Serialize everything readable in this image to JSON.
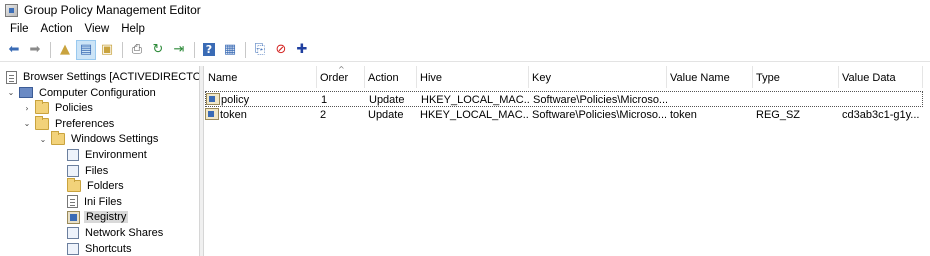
{
  "window": {
    "title": "Group Policy Management Editor"
  },
  "menu": [
    "File",
    "Action",
    "View",
    "Help"
  ],
  "toolbar": {
    "buttons": [
      {
        "name": "back-button",
        "icon": "arrow-left-icon",
        "glyph": "⬅",
        "color": "#3a6bb5"
      },
      {
        "name": "forward-button",
        "icon": "arrow-right-icon",
        "glyph": "➡",
        "color": "#8a8a8a"
      },
      {
        "name": "up-folder-button",
        "icon": "up-folder-icon",
        "glyph": "▲",
        "color": "#c9a33e"
      },
      {
        "name": "show-hide-tree-button",
        "icon": "console-tree-icon",
        "glyph": "▤",
        "color": "#3a6bb5",
        "active": true
      },
      {
        "name": "copy-button",
        "icon": "clipboard-icon",
        "glyph": "▣",
        "color": "#c9a33e"
      },
      {
        "name": "print-button",
        "icon": "printer-icon",
        "glyph": "⎙",
        "color": "#555555"
      },
      {
        "name": "refresh-button",
        "icon": "refresh-icon",
        "glyph": "↻",
        "color": "#2e8b3a"
      },
      {
        "name": "export-list-button",
        "icon": "export-icon",
        "glyph": "⇥",
        "color": "#2e8b3a"
      },
      {
        "name": "help-button",
        "icon": "help-icon",
        "glyph": "?",
        "color": "#ffffff",
        "bg": "#3a6bb5"
      },
      {
        "name": "properties-button",
        "icon": "properties-icon",
        "glyph": "▦",
        "color": "#3a6bb5"
      },
      {
        "name": "new-item-button",
        "icon": "new-document-icon",
        "glyph": "⎘",
        "color": "#3a6bb5"
      },
      {
        "name": "disable-item-button",
        "icon": "prohibited-icon",
        "glyph": "⊘",
        "color": "#d3201e"
      },
      {
        "name": "add-item-button",
        "icon": "plus-icon",
        "glyph": "✚",
        "color": "#1f3f9f"
      }
    ]
  },
  "tree": [
    {
      "label": "Browser Settings [ACTIVEDIRECTORY.I",
      "icon": "policy-document-icon",
      "icon_class": "doc",
      "level": 0,
      "chevron": ""
    },
    {
      "label": "Computer Configuration",
      "icon": "computer-icon",
      "icon_class": "computer",
      "level": 0,
      "chevron": "⌄"
    },
    {
      "label": "Policies",
      "icon": "folder-icon",
      "icon_class": "folder",
      "level": 1,
      "chevron": "›"
    },
    {
      "label": "Preferences",
      "icon": "folder-icon",
      "icon_class": "folder",
      "level": 1,
      "chevron": "⌄"
    },
    {
      "label": "Windows Settings",
      "icon": "folder-icon",
      "icon_class": "folder",
      "level": 2,
      "chevron": "⌄"
    },
    {
      "label": "Environment",
      "icon": "environment-icon",
      "icon_class": "generic",
      "level": 3,
      "chevron": ""
    },
    {
      "label": "Files",
      "icon": "files-icon",
      "icon_class": "generic",
      "level": 3,
      "chevron": ""
    },
    {
      "label": "Folders",
      "icon": "folders-icon",
      "icon_class": "folder",
      "level": 3,
      "chevron": ""
    },
    {
      "label": "Ini Files",
      "icon": "ini-files-icon",
      "icon_class": "doc",
      "level": 3,
      "chevron": ""
    },
    {
      "label": "Registry",
      "icon": "registry-icon",
      "icon_class": "registry",
      "level": 3,
      "chevron": "",
      "selected": true
    },
    {
      "label": "Network Shares",
      "icon": "network-shares-icon",
      "icon_class": "generic",
      "level": 3,
      "chevron": ""
    },
    {
      "label": "Shortcuts",
      "icon": "shortcuts-icon",
      "icon_class": "generic",
      "level": 3,
      "chevron": ""
    }
  ],
  "table": {
    "columns": [
      "Name",
      "Order",
      "Action",
      "Hive",
      "Key",
      "Value Name",
      "Type",
      "Value Data"
    ],
    "sorted_column": "Order",
    "sort_indicator": "^",
    "rows": [
      {
        "name": "policy",
        "order": "1",
        "action": "Update",
        "hive": "HKEY_LOCAL_MAC...",
        "key": "Software\\Policies\\Microso...",
        "value_name": "",
        "type": "",
        "value_data": "",
        "focused": true
      },
      {
        "name": "token",
        "order": "2",
        "action": "Update",
        "hive": "HKEY_LOCAL_MAC...",
        "key": "Software\\Policies\\Microso...",
        "value_name": "token",
        "type": "REG_SZ",
        "value_data": "cd3ab3c1-g1y...",
        "focused": false
      }
    ]
  }
}
